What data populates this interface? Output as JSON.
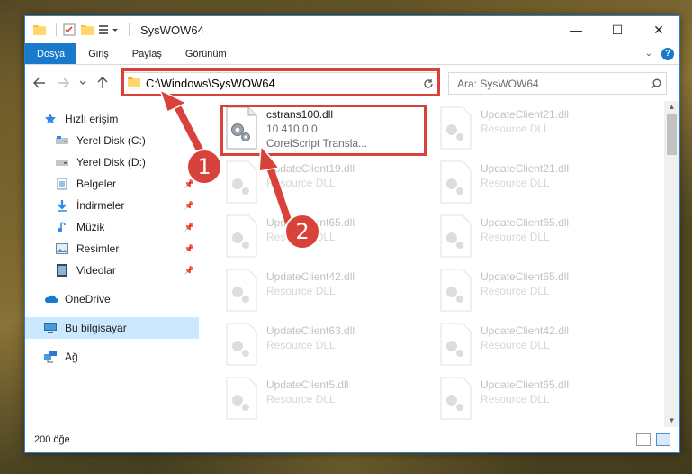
{
  "window": {
    "title": "SysWOW64",
    "controls": {
      "minimize": "—",
      "maximize": "☐",
      "close": "✕"
    }
  },
  "ribbon": {
    "tabs": [
      "Dosya",
      "Giriş",
      "Paylaş",
      "Görünüm"
    ],
    "help": "?"
  },
  "address": {
    "path": "C:\\Windows\\SysWOW64",
    "search_placeholder": "Ara: SysWOW64"
  },
  "sidebar": {
    "items": [
      {
        "label": "Hızlı erişim",
        "icon": "star-icon",
        "pinned": false
      },
      {
        "label": "Yerel Disk (C:)",
        "icon": "drive-icon",
        "pinned": false
      },
      {
        "label": "Yerel Disk (D:)",
        "icon": "drive-icon",
        "pinned": false
      },
      {
        "label": "Belgeler",
        "icon": "documents-icon",
        "pinned": true
      },
      {
        "label": "İndirmeler",
        "icon": "download-icon",
        "pinned": true
      },
      {
        "label": "Müzik",
        "icon": "music-icon",
        "pinned": true
      },
      {
        "label": "Resimler",
        "icon": "pictures-icon",
        "pinned": true
      },
      {
        "label": "Videolar",
        "icon": "videos-icon",
        "pinned": true
      },
      {
        "label": "OneDrive",
        "icon": "cloud-icon",
        "pinned": false
      },
      {
        "label": "Bu bilgisayar",
        "icon": "computer-icon",
        "pinned": false
      },
      {
        "label": "Ağ",
        "icon": "network-icon",
        "pinned": false
      }
    ]
  },
  "files": {
    "highlighted": {
      "name": "cstrans100.dll",
      "version": "10.410.0.0",
      "description": "CorelScript Transla..."
    },
    "faded": [
      {
        "name": "UpdateClient21.dll",
        "description": "Resource DLL"
      },
      {
        "name": "UpdateClient19.dll",
        "description": "Resource DLL"
      },
      {
        "name": "UpdateClient21.dll",
        "description": "Resource DLL"
      },
      {
        "name": "UpdateClient65.dll",
        "description": "Resource DLL"
      },
      {
        "name": "UpdateClient65.dll",
        "description": "Resource DLL"
      },
      {
        "name": "UpdateClient42.dll",
        "description": "Resource DLL"
      },
      {
        "name": "UpdateClient65.dll",
        "description": "Resource DLL"
      },
      {
        "name": "UpdateClient63.dll",
        "description": "Resource DLL"
      },
      {
        "name": "UpdateClient42.dll",
        "description": "Resource DLL"
      },
      {
        "name": "UpdateClient5.dll",
        "description": "Resource DLL"
      },
      {
        "name": "UpdateClient65.dll",
        "description": "Resource DLL"
      }
    ]
  },
  "status": {
    "item_count": "200 öğe"
  },
  "annotations": {
    "badge1": "1",
    "badge2": "2",
    "color": "#d9413b"
  }
}
